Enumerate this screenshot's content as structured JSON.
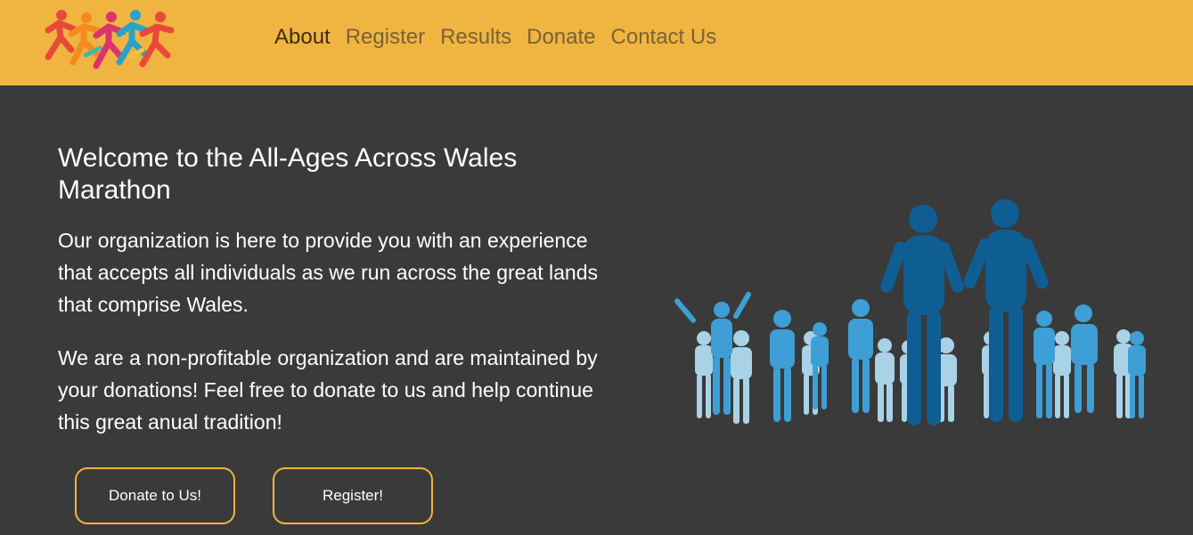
{
  "header": {
    "logo_icon": "runners-logo-icon",
    "nav": [
      {
        "label": "About",
        "active": true
      },
      {
        "label": "Register",
        "active": false
      },
      {
        "label": "Results",
        "active": false
      },
      {
        "label": "Donate",
        "active": false
      },
      {
        "label": "Contact Us",
        "active": false
      }
    ]
  },
  "main": {
    "title": "Welcome to the All-Ages Across Wales Marathon",
    "paragraph1": "Our organization is here to provide you with an experience that accepts all individuals as we run across the great lands that comprise Wales.",
    "paragraph2": "We are a non-profitable organization and are maintained by your donations! Feel free to donate to us and help continue this great anual tradition!",
    "donate_button": "Donate to Us!",
    "register_button": "Register!",
    "illustration_icon": "runners-crowd-icon"
  },
  "colors": {
    "header_bg": "#f0b441",
    "page_bg": "#3a3a3a",
    "button_border": "#f0b441",
    "crowd_dark": "#0e5e94",
    "crowd_mid": "#3d9fd6",
    "crowd_light": "#a9d2e6"
  }
}
